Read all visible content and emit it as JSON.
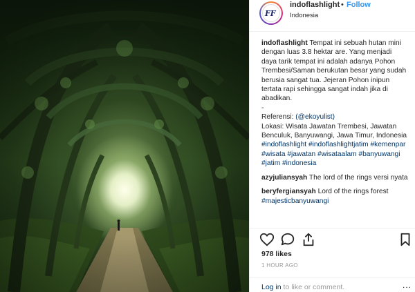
{
  "post": {
    "avatar_initials": "FF",
    "username": "indoflashlight",
    "separator": "•",
    "follow_label": "Follow",
    "location": "Indonesia"
  },
  "caption": {
    "author": "indoflashlight",
    "text": "Tempat ini sebuah hutan mini dengan luas 3.8 hektar are. Yang menjadi daya tarik tempat ini adalah adanya Pohon Trembesi/Saman berukutan besar yang sudah berusia sangat tua. Jejeran Pohon inipun tertata rapi sehingga sangat indah jika di abadikan.",
    "dash": "-",
    "referensi_label": "Referensi: ",
    "referensi_handle": "(@ekoyulist)",
    "lokasi": "Lokasi: Wisata Jawatan Trembesi, Jawatan Benculuk, Banyuwangi, Jawa Timur, Indonesia",
    "hashtags": "#indoflashlight #indoflashlightjatim #kemenpar #wisata #jawatan #wisataalam #banyuwangi #jatim #indonesia"
  },
  "comments": [
    {
      "user": "azyjuliansyah",
      "text": "The lord of the rings versi nyata"
    },
    {
      "user": "beryfergiansyah",
      "text": "Lord of the rings forest",
      "tag": "#majesticbanyuwangi"
    }
  ],
  "actions": {
    "like_icon": "heart-icon",
    "comment_icon": "comment-bubble-icon",
    "share_icon": "share-icon",
    "save_icon": "bookmark-icon"
  },
  "likes": "978 likes",
  "time": "1 HOUR AGO",
  "login": {
    "link": "Log in",
    "rest": " to like or comment.",
    "more": "..."
  },
  "colors": {
    "link_blue": "#3897f0",
    "dark_link": "#003569",
    "text": "#262626",
    "muted": "#999999"
  }
}
